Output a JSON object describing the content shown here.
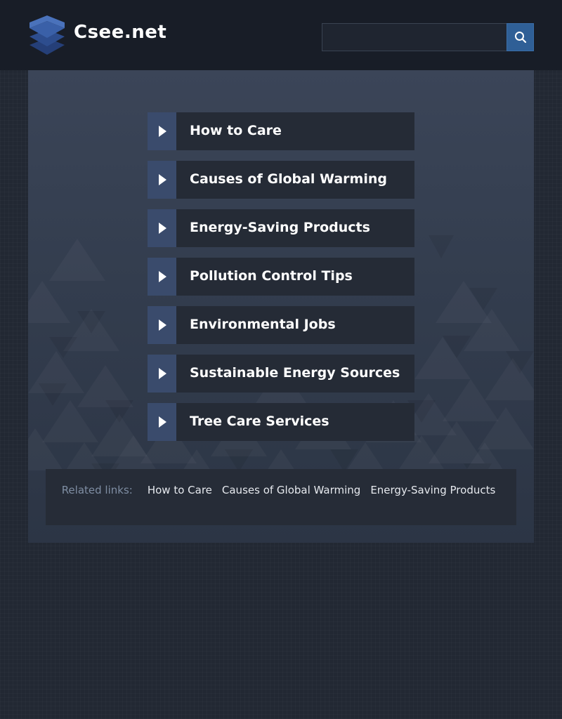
{
  "header": {
    "logo_text": "Csee.net",
    "logo_icon": "stacked-layers-icon",
    "search_placeholder": "",
    "search_icon": "magnifier-icon"
  },
  "menu": {
    "items": [
      {
        "label": "How to Care"
      },
      {
        "label": "Causes of Global Warming"
      },
      {
        "label": "Energy-Saving Products"
      },
      {
        "label": "Pollution Control Tips"
      },
      {
        "label": "Environmental Jobs"
      },
      {
        "label": "Sustainable Energy Sources"
      },
      {
        "label": "Tree Care Services"
      }
    ],
    "arrow_icon": "play-triangle-icon"
  },
  "related": {
    "label": "Related links:",
    "links": [
      {
        "label": "How to Care"
      },
      {
        "label": "Causes of Global Warming"
      },
      {
        "label": "Energy-Saving Products"
      }
    ]
  },
  "colors": {
    "page_background": "#222833",
    "header_background": "#181d27",
    "accent_blue": "#2f5f96",
    "item_background": "#252b36",
    "item_arrow_background": "#3a4b6c",
    "related_label": "#7f8ea3"
  }
}
